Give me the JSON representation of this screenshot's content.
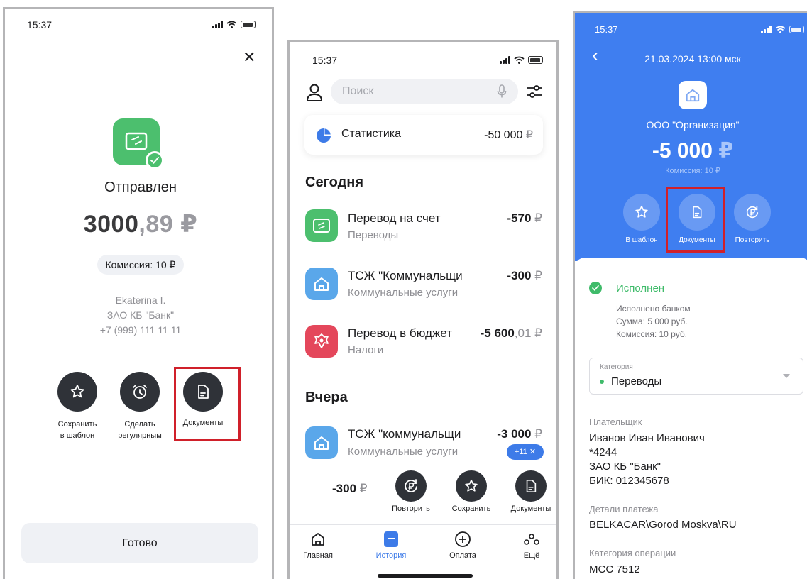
{
  "screen1": {
    "status_time": "15:37",
    "close": "✕",
    "title": "Отправлен",
    "amount_int": "3000",
    "amount_frac": ",89 ₽",
    "commission": "Комиссия: 10 ₽",
    "recipient_name": "Ekaterina I.",
    "recipient_bank": "ЗАО КБ \"Банк\"",
    "recipient_phone": "+7 (999) 111 11 11",
    "actions": {
      "save_line1": "Сохранить",
      "save_line2": "в шаблон",
      "regular_line1": "Сделать",
      "regular_line2": "регулярным",
      "documents": "Документы"
    },
    "done": "Готово"
  },
  "screen2": {
    "status_time": "15:37",
    "search_placeholder": "Поиск",
    "stats_label": "Статистика",
    "stats_amount": "-50 000",
    "today_header": "Сегодня",
    "yesterday_header": "Вчера",
    "transactions": [
      {
        "title": "Перевод на счет",
        "subtitle": "Переводы",
        "amount": "-570",
        "currency": "₽"
      },
      {
        "title": "ТСЖ \"Коммунальщи",
        "subtitle": "Коммунальные услуги",
        "amount": "-300",
        "currency": "₽"
      },
      {
        "title": "Перевод в бюджет",
        "subtitle": "Налоги",
        "amount": "-5 600",
        "fraction": ",01 ₽"
      },
      {
        "title": "ТСЖ \"коммунальщи",
        "subtitle": "Коммунальные услуги",
        "amount": "-3 000",
        "currency": "₽"
      }
    ],
    "badge": "+11",
    "badge_close": "✕",
    "swipe_amount": "-300",
    "swipe_currency": "₽",
    "swipe_actions": {
      "repeat": "Повторить",
      "save": "Сохранить",
      "documents": "Документы"
    },
    "nav": {
      "home": "Главная",
      "history": "История",
      "payment": "Оплата",
      "more": "Ещё"
    },
    "colors": {
      "history_active": "#3d7be8",
      "transfer_green": "#4cbf6e",
      "housing_blue": "#5aa7ea",
      "budget_red": "#e4475b"
    }
  },
  "screen3": {
    "status_time": "15:37",
    "back": "‹",
    "date": "21.03.2024 13:00 мск",
    "org_name": "ООО \"Организация\"",
    "amount": "-5 000",
    "amount_currency": "₽",
    "commission": "Комиссия: 10 ₽",
    "actions": {
      "template": "В шаблон",
      "documents": "Документы",
      "repeat": "Повторить"
    },
    "status": "Исполнен",
    "status_details": [
      "Исполнено банком",
      "Сумма: 5 000 руб.",
      "Комиссия: 10 руб."
    ],
    "category_label": "Категория",
    "category_value": "Переводы",
    "payer_label": "Плательщик",
    "payer_lines": [
      "Иванов Иван Иванович",
      "*4244",
      "ЗАО КБ \"Банк\"",
      "БИК: 012345678"
    ],
    "details_label": "Детали платежа",
    "details_value": "BELKACAR\\Gorod Moskva\\RU",
    "op_category_label": "Категория операции",
    "op_category_value": "МСС 7512",
    "colors": {
      "header_blue": "#3f7ef0",
      "status_green": "#3fbb6a"
    }
  }
}
